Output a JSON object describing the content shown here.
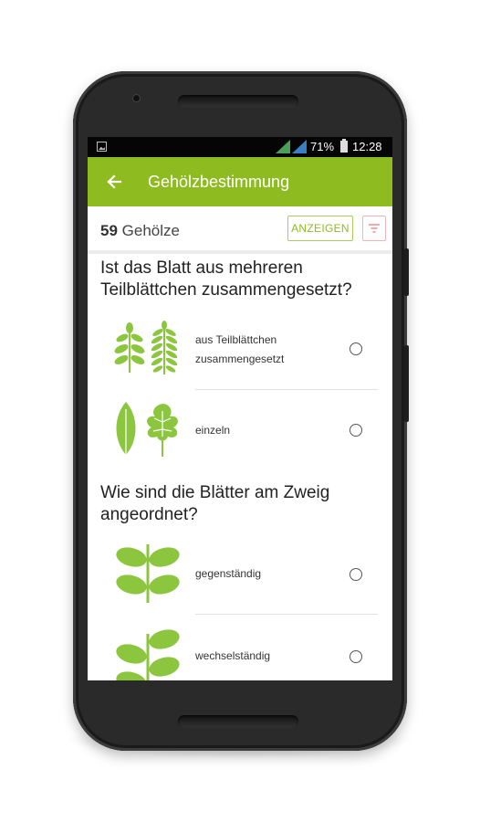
{
  "status_bar": {
    "battery_percent": "71%",
    "time": "12:28"
  },
  "app_bar": {
    "title": "Gehölzbestimmung",
    "back_icon": "arrow-left-icon"
  },
  "count_bar": {
    "count": "59",
    "count_label": "Gehölze",
    "show_button": "ANZEIGEN",
    "filter_icon": "filter-icon"
  },
  "questions": [
    {
      "text": "Ist das Blatt aus mehreren Teilblättchen zusammengesetzt?",
      "options": [
        {
          "label": "aus Teilblättchen zusammengesetzt",
          "icon": "compound-leaves-icon",
          "selected": false
        },
        {
          "label": "einzeln",
          "icon": "simple-leaves-icon",
          "selected": false
        }
      ]
    },
    {
      "text": "Wie sind die Blätter am Zweig angeordnet?",
      "options": [
        {
          "label": "gegenständig",
          "icon": "opposite-leaves-icon",
          "selected": false
        },
        {
          "label": "wechselständig",
          "icon": "alternate-leaves-icon",
          "selected": false
        }
      ]
    }
  ],
  "colors": {
    "accent": "#8ebb20",
    "leaf_green": "#8cc63f",
    "filter_pink": "#f2b4b4"
  }
}
